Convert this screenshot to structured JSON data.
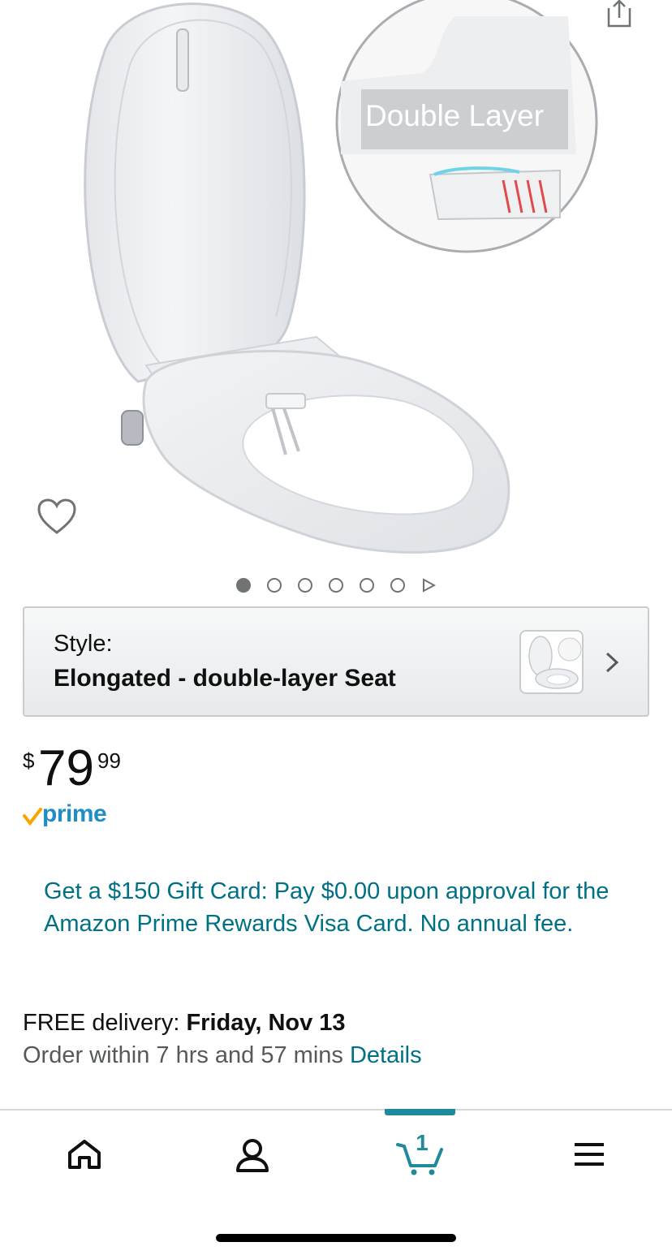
{
  "product": {
    "image_callout": "Double Layer",
    "carousel": {
      "total_images": 6,
      "active_index": 0
    }
  },
  "style_selector": {
    "label": "Style:",
    "value": "Elongated - double-layer Seat"
  },
  "price": {
    "symbol": "$",
    "whole": "79",
    "fraction": "99"
  },
  "prime": {
    "label": "prime"
  },
  "promo": {
    "text": "Get a $150 Gift Card: Pay $0.00 upon approval for the Amazon Prime Rewards Visa Card. No annual fee."
  },
  "delivery": {
    "prefix": "FREE delivery: ",
    "date": "Friday, Nov 13",
    "order_within": "Order within 7 hrs and 57 mins ",
    "details_link": "Details"
  },
  "bottom_nav": {
    "cart_count": "1",
    "items": [
      "home-icon",
      "account-icon",
      "cart-icon",
      "menu-icon"
    ],
    "active": "cart"
  },
  "colors": {
    "link": "#007185",
    "prime_blue": "#1f8ec6",
    "prime_check": "#f7a600",
    "nav_active": "#1f8a9c",
    "text": "#0f1111"
  }
}
